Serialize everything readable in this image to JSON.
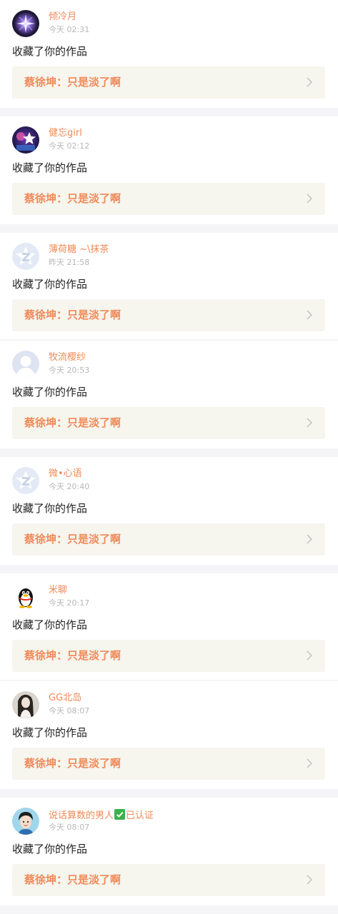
{
  "notifications": [
    {
      "name": "倾冷月",
      "time": "今天 02:31",
      "action": "收藏了你的作品",
      "work_title": "蔡徐坤：只是淡了啊",
      "avatar": "dark-glow-avatar"
    },
    {
      "name": "健忘girl",
      "time": "今天 02:12",
      "action": "收藏了你的作品",
      "work_title": "蔡徐坤：只是淡了啊",
      "avatar": "purple-star-avatar"
    },
    {
      "name": "薄荷糖 ~\\抹茶",
      "time": "昨天 21:58",
      "action": "收藏了你的作品",
      "work_title": "蔡徐坤：只是淡了啊",
      "avatar": "default-z-avatar"
    },
    {
      "name": "牧流樱纱",
      "time": "今天 20:53",
      "action": "收藏了你的作品",
      "work_title": "蔡徐坤：只是淡了啊",
      "avatar": "default-person-avatar"
    },
    {
      "name": "微•心语",
      "time": "今天 20:40",
      "action": "收藏了你的作品",
      "work_title": "蔡徐坤：只是淡了啊",
      "avatar": "default-z-avatar"
    },
    {
      "name": "米聊",
      "time": "今天 20:17",
      "action": "收藏了你的作品",
      "work_title": "蔡徐坤：只是淡了啊",
      "avatar": "penguin-avatar"
    },
    {
      "name": "GG北岛",
      "time": "今天 08:07",
      "action": "收藏了你的作品",
      "work_title": "蔡徐坤：只是淡了啊",
      "avatar": "photo-avatar"
    },
    {
      "name_prefix": "说话算数的男人",
      "name_suffix": "已认证",
      "time": "今天 08:07",
      "action": "收藏了你的作品",
      "work_title": "蔡徐坤：只是淡了啊",
      "avatar": "cartoon-boy-avatar"
    }
  ],
  "colors": {
    "accent": "#f08a58",
    "time": "#b7b7b7",
    "work_bg": "#f6f5ee",
    "verified": "#37b34a",
    "page_bg": "#f5f5f7"
  }
}
